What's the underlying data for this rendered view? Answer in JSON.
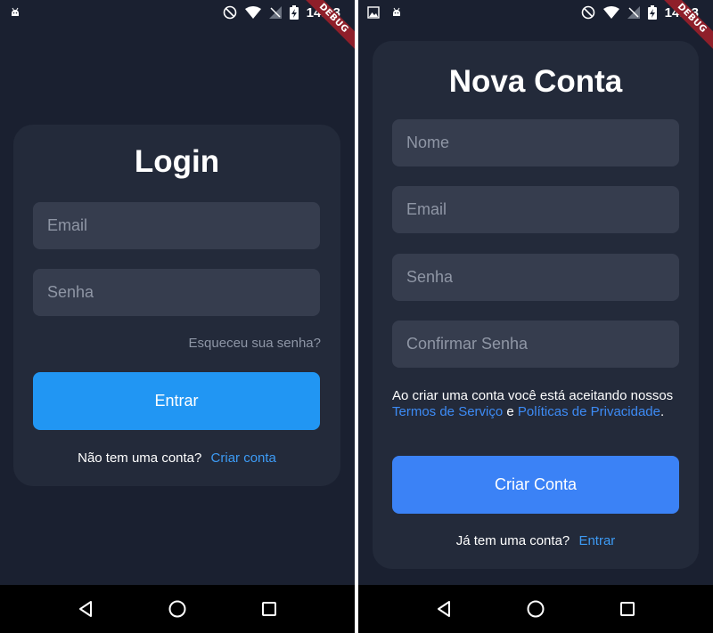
{
  "status_bar": {
    "time": "14:03",
    "debug_banner": "DEBUG"
  },
  "login": {
    "title": "Login",
    "email_placeholder": "Email",
    "password_placeholder": "Senha",
    "forgot_password": "Esqueceu sua senha?",
    "submit_label": "Entrar",
    "footer_text": "Não tem uma conta?",
    "footer_link": "Criar conta"
  },
  "signup": {
    "title": "Nova Conta",
    "name_placeholder": "Nome",
    "email_placeholder": "Email",
    "password_placeholder": "Senha",
    "confirm_password_placeholder": "Confirmar Senha",
    "terms_prefix": "Ao criar uma conta você está aceitando nossos",
    "terms_link": "Termos de Serviço",
    "terms_and": "e",
    "privacy_link": "Políticas de Privacidade",
    "terms_suffix": ".",
    "submit_label": "Criar Conta",
    "footer_text": "Já tem uma conta?",
    "footer_link": "Entrar"
  },
  "navigation": {
    "back_icon": "back-triangle-icon",
    "home_icon": "home-circle-icon",
    "recents_icon": "recents-square-icon"
  },
  "colors": {
    "background": "#1a2030",
    "card": "#232a3a",
    "field": "#363d4e",
    "login_button": "#2196f3",
    "signup_button": "#3b82f6",
    "link": "#3d9bf5",
    "debug_ribbon": "#8f1f2a"
  }
}
